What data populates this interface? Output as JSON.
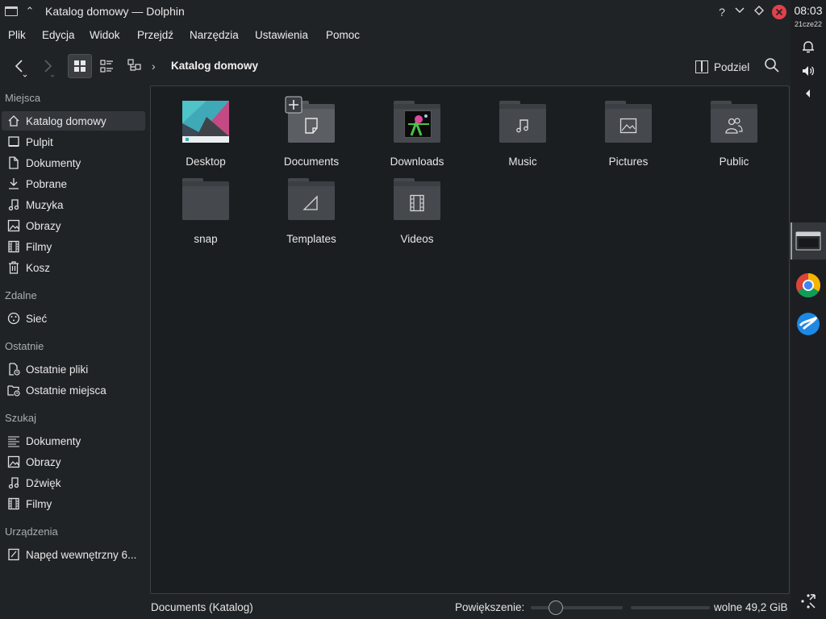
{
  "window": {
    "title": "Katalog domowy — Dolphin"
  },
  "menubar": [
    "Plik",
    "Edycja",
    "Widok",
    "Przejdź",
    "Narzędzia",
    "Ustawienia",
    "Pomoc"
  ],
  "toolbar": {
    "breadcrumb": "Katalog domowy",
    "split_label": "Podziel"
  },
  "sidebar": {
    "sections": [
      {
        "title": "Miejsca",
        "items": [
          {
            "label": "Katalog domowy",
            "icon": "home-icon",
            "selected": true
          },
          {
            "label": "Pulpit",
            "icon": "desktop-icon"
          },
          {
            "label": "Dokumenty",
            "icon": "documents-icon"
          },
          {
            "label": "Pobrane",
            "icon": "download-icon"
          },
          {
            "label": "Muzyka",
            "icon": "music-icon"
          },
          {
            "label": "Obrazy",
            "icon": "image-icon"
          },
          {
            "label": "Filmy",
            "icon": "film-icon"
          },
          {
            "label": "Kosz",
            "icon": "trash-icon"
          }
        ]
      },
      {
        "title": "Zdalne",
        "items": [
          {
            "label": "Sieć",
            "icon": "network-icon"
          }
        ]
      },
      {
        "title": "Ostatnie",
        "items": [
          {
            "label": "Ostatnie pliki",
            "icon": "recent-files-icon"
          },
          {
            "label": "Ostatnie miejsca",
            "icon": "recent-places-icon"
          }
        ]
      },
      {
        "title": "Szukaj",
        "items": [
          {
            "label": "Dokumenty",
            "icon": "search-documents-icon"
          },
          {
            "label": "Obrazy",
            "icon": "search-images-icon"
          },
          {
            "label": "Dźwięk",
            "icon": "search-audio-icon"
          },
          {
            "label": "Filmy",
            "icon": "search-video-icon"
          }
        ]
      },
      {
        "title": "Urządzenia",
        "items": [
          {
            "label": "Napęd wewnętrzny 6...",
            "icon": "drive-icon"
          }
        ]
      }
    ]
  },
  "files": [
    {
      "name": "Desktop",
      "icon": "desktop-folder-icon"
    },
    {
      "name": "Documents",
      "icon": "documents-folder-icon"
    },
    {
      "name": "Downloads",
      "icon": "downloads-folder-icon"
    },
    {
      "name": "Music",
      "icon": "music-folder-icon"
    },
    {
      "name": "Pictures",
      "icon": "pictures-folder-icon"
    },
    {
      "name": "Public",
      "icon": "public-folder-icon"
    },
    {
      "name": "snap",
      "icon": "folder-icon"
    },
    {
      "name": "Templates",
      "icon": "templates-folder-icon"
    },
    {
      "name": "Videos",
      "icon": "videos-folder-icon"
    }
  ],
  "statusbar": {
    "selection": "Documents (Katalog)",
    "zoom_label": "Powiększenie:",
    "zoom_level": 0.2,
    "free_space": "wolne 49,2 GiB"
  },
  "panel": {
    "time": "08:03",
    "date": "21cze22"
  },
  "colors": {
    "background": "#202326",
    "view_background": "#1b1e21",
    "close_button": "#e0424b",
    "selection": "#33373c"
  }
}
